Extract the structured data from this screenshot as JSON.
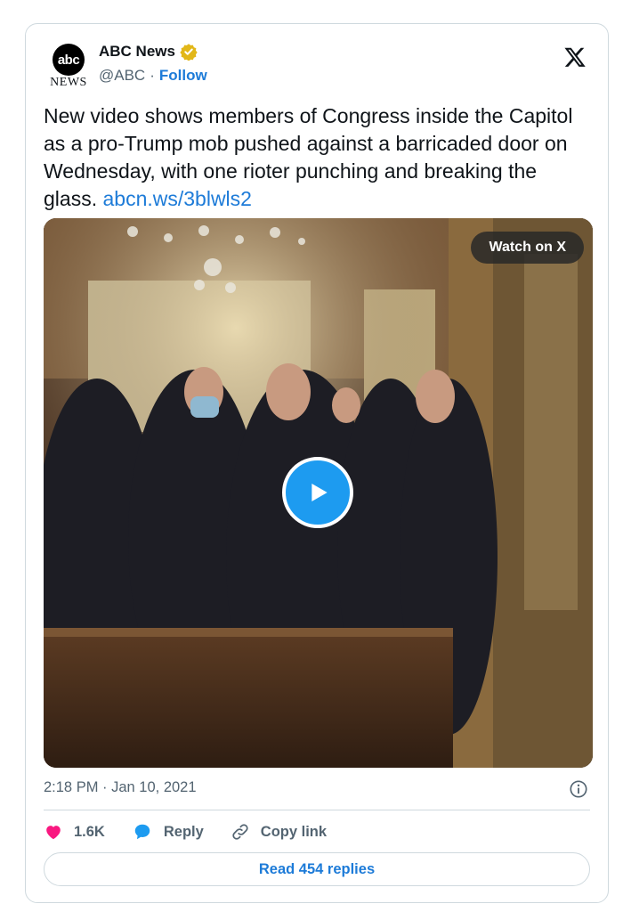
{
  "account": {
    "avatar_text": "abc",
    "avatar_subtext": "NEWS",
    "name": "ABC News",
    "handle": "@ABC",
    "separator": "·",
    "follow_label": "Follow"
  },
  "tweet": {
    "text": "New video shows members of Congress inside the Capitol as a pro-Trump mob pushed against a barricaded door on Wednesday, with one rioter punching and breaking the glass.",
    "link": "abcn.ws/3blwls2"
  },
  "media": {
    "watch_label": "Watch on X"
  },
  "meta": {
    "timestamp": "2:18 PM · Jan 10, 2021"
  },
  "actions": {
    "likes": "1.6K",
    "reply_label": "Reply",
    "copy_label": "Copy link"
  },
  "read_replies_label": "Read 454 replies",
  "colors": {
    "link": "#1d7bd8",
    "like": "#f91880",
    "verified": "#e2b719",
    "play": "#1d9bf0"
  }
}
